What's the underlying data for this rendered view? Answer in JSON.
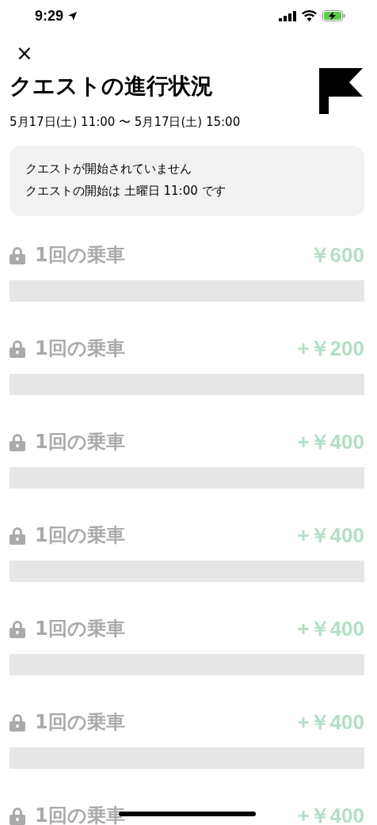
{
  "status_bar": {
    "time": "9:29"
  },
  "header": {
    "close": "×",
    "title": "クエストの進行状況",
    "date_range": "5月17日(土) 11:00 〜 5月17日(土) 15:00"
  },
  "notice": {
    "heading": "クエストが開始されていません",
    "message": "クエストの開始は 土曜日 11:00 です"
  },
  "rows": [
    {
      "label": "1回の乗車",
      "amount": "￥600",
      "locked": true
    },
    {
      "label": "1回の乗車",
      "amount": "+￥200",
      "locked": true
    },
    {
      "label": "1回の乗車",
      "amount": "+￥400",
      "locked": true
    },
    {
      "label": "1回の乗車",
      "amount": "+￥400",
      "locked": true
    },
    {
      "label": "1回の乗車",
      "amount": "+￥400",
      "locked": true
    },
    {
      "label": "1回の乗車",
      "amount": "+￥400",
      "locked": true
    },
    {
      "label": "1回の乗車",
      "amount": "+￥400",
      "locked": true
    }
  ]
}
